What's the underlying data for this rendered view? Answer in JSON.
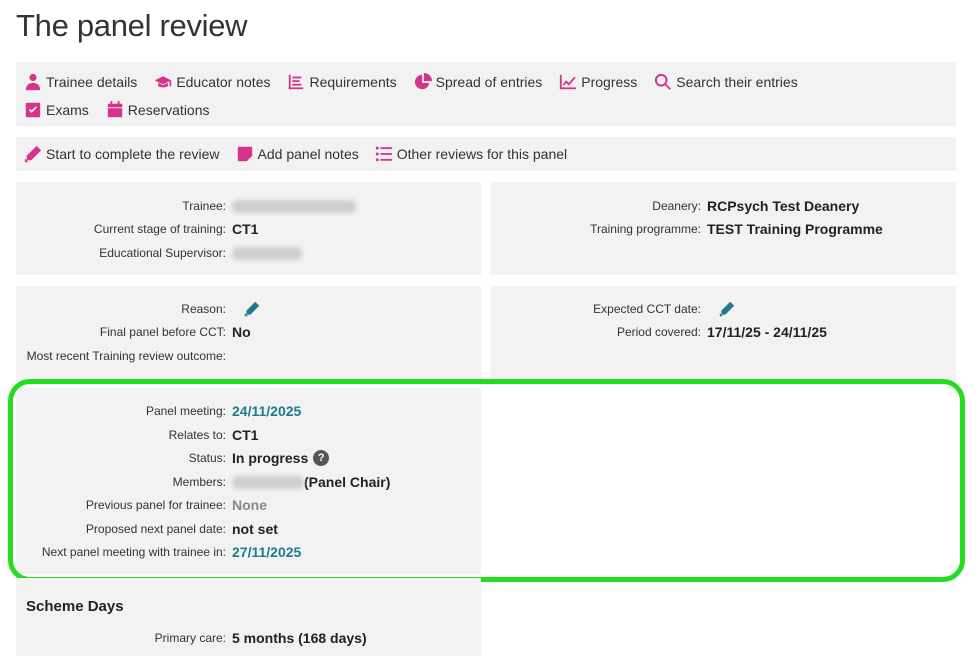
{
  "page": {
    "title": "The panel review"
  },
  "nav": {
    "row1": [
      {
        "icon": "user-icon",
        "label": "Trainee details"
      },
      {
        "icon": "graduation-cap-icon",
        "label": "Educator notes"
      },
      {
        "icon": "list-icon",
        "label": "Requirements"
      },
      {
        "icon": "pie-chart-icon",
        "label": "Spread of entries"
      },
      {
        "icon": "line-chart-icon",
        "label": "Progress"
      },
      {
        "icon": "search-icon",
        "label": "Search their entries"
      }
    ],
    "row2": [
      {
        "icon": "checkbox-icon",
        "label": "Exams"
      },
      {
        "icon": "calendar-icon",
        "label": "Reservations"
      }
    ]
  },
  "actions": {
    "complete": "Start to complete the review",
    "add_notes": "Add panel notes",
    "other_reviews": "Other reviews for this panel"
  },
  "trainee_panel": {
    "trainee_label": "Trainee:",
    "stage_label": "Current stage of training:",
    "stage_value": "CT1",
    "supervisor_label": "Educational Supervisor:"
  },
  "deanery_panel": {
    "deanery_label": "Deanery:",
    "deanery_value": "RCPsych Test Deanery",
    "programme_label": "Training programme:",
    "programme_value": "TEST Training Programme"
  },
  "reason_panel": {
    "reason_label": "Reason:",
    "final_label": "Final panel before CCT:",
    "final_value": "No",
    "outcome_label": "Most recent Training review outcome:"
  },
  "cct_panel": {
    "cct_label": "Expected CCT date:",
    "period_label": "Period covered:",
    "period_value": "17/11/25 - 24/11/25"
  },
  "meeting_panel": {
    "meeting_label": "Panel meeting:",
    "meeting_value": "24/11/2025",
    "relates_label": "Relates to:",
    "relates_value": "CT1",
    "status_label": "Status:",
    "status_value": "In progress",
    "members_label": "Members:",
    "members_role": "(Panel Chair)",
    "previous_label": "Previous panel for trainee:",
    "previous_value": "None",
    "proposed_label": "Proposed next panel date:",
    "proposed_value": "not set",
    "next_label": "Next panel meeting with trainee in:",
    "next_value": "27/11/2025"
  },
  "scheme": {
    "title": "Scheme Days",
    "primary_label": "Primary care:",
    "primary_value": "5 months (168 days)"
  },
  "colors": {
    "accent": "#d6338a",
    "link": "#1e7a8c",
    "highlight": "#22dd22"
  }
}
